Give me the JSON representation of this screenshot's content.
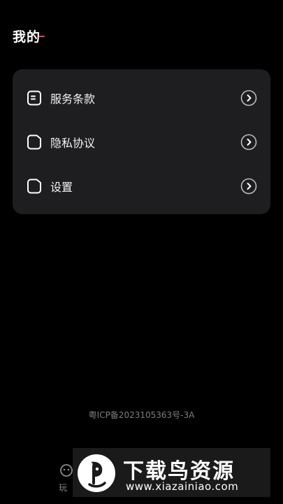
{
  "page": {
    "title": "我的"
  },
  "menu": {
    "items": [
      {
        "label": "服务条款",
        "icon": "document-icon",
        "chevron": "chevron-right-icon"
      },
      {
        "label": "隐私协议",
        "icon": "page-icon",
        "chevron": "chevron-right-icon"
      },
      {
        "label": "设置",
        "icon": "page-icon",
        "chevron": "chevron-right-icon"
      }
    ]
  },
  "footer": {
    "icp": "粤ICP备2023105363号-3A"
  },
  "bottom_nav": {
    "left_label": "玩"
  },
  "watermark": {
    "title": "下载鸟资源",
    "url": "www.xiazainiao.com"
  },
  "colors": {
    "background": "#000000",
    "card": "#1e1e20",
    "accent": "#ff3b8a",
    "text": "#ffffff",
    "muted": "#7d7d7d"
  }
}
